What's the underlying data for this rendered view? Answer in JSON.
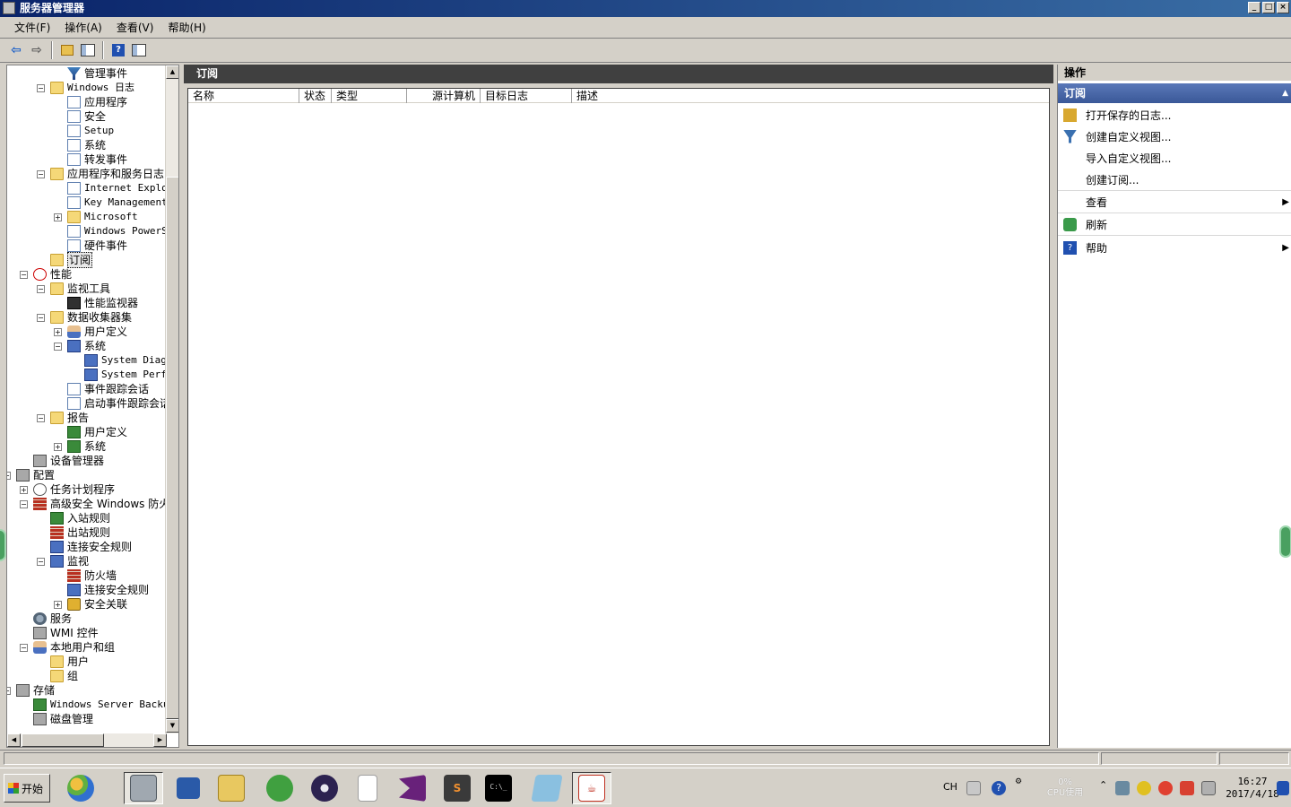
{
  "window": {
    "title": "服务器管理器"
  },
  "menu": [
    "文件(F)",
    "操作(A)",
    "查看(V)",
    "帮助(H)"
  ],
  "tree": [
    {
      "label": "管理事件",
      "depth": 3,
      "icon": "filter",
      "expander": ""
    },
    {
      "label": "Windows 日志",
      "depth": 2,
      "icon": "folder",
      "expander": "−",
      "mono": true
    },
    {
      "label": "应用程序",
      "depth": 3,
      "icon": "log",
      "expander": ""
    },
    {
      "label": "安全",
      "depth": 3,
      "icon": "log",
      "expander": ""
    },
    {
      "label": "Setup",
      "depth": 3,
      "icon": "log",
      "expander": "",
      "mono": true
    },
    {
      "label": "系统",
      "depth": 3,
      "icon": "log",
      "expander": ""
    },
    {
      "label": "转发事件",
      "depth": 3,
      "icon": "log",
      "expander": ""
    },
    {
      "label": "应用程序和服务日志",
      "depth": 2,
      "icon": "folder",
      "expander": "−"
    },
    {
      "label": "Internet Explor",
      "depth": 3,
      "icon": "log",
      "expander": "",
      "mono": true
    },
    {
      "label": "Key Management",
      "depth": 3,
      "icon": "log",
      "expander": "",
      "mono": true
    },
    {
      "label": "Microsoft",
      "depth": 3,
      "icon": "folder",
      "expander": "+",
      "mono": true
    },
    {
      "label": "Windows PowerSl",
      "depth": 3,
      "icon": "log",
      "expander": "",
      "mono": true
    },
    {
      "label": "硬件事件",
      "depth": 3,
      "icon": "log",
      "expander": ""
    },
    {
      "label": "订阅",
      "depth": 2,
      "icon": "folder",
      "expander": "",
      "selected": true
    },
    {
      "label": "性能",
      "depth": 1,
      "icon": "perf",
      "expander": "−"
    },
    {
      "label": "监视工具",
      "depth": 2,
      "icon": "folder",
      "expander": "−"
    },
    {
      "label": "性能监视器",
      "depth": 3,
      "icon": "monitor",
      "expander": ""
    },
    {
      "label": "数据收集器集",
      "depth": 2,
      "icon": "folder",
      "expander": "−"
    },
    {
      "label": "用户定义",
      "depth": 3,
      "icon": "user",
      "expander": "+"
    },
    {
      "label": "系统",
      "depth": 3,
      "icon": "blue",
      "expander": "−"
    },
    {
      "label": "System Diag",
      "depth": 4,
      "icon": "blue",
      "expander": "",
      "mono": true
    },
    {
      "label": "System Perf",
      "depth": 4,
      "icon": "blue",
      "expander": "",
      "mono": true
    },
    {
      "label": "事件跟踪会话",
      "depth": 3,
      "icon": "log",
      "expander": ""
    },
    {
      "label": "启动事件跟踪会话",
      "depth": 3,
      "icon": "log",
      "expander": ""
    },
    {
      "label": "报告",
      "depth": 2,
      "icon": "folder",
      "expander": "−"
    },
    {
      "label": "用户定义",
      "depth": 3,
      "icon": "green",
      "expander": ""
    },
    {
      "label": "系统",
      "depth": 3,
      "icon": "green",
      "expander": "+"
    },
    {
      "label": "设备管理器",
      "depth": 1,
      "icon": "pc",
      "expander": ""
    },
    {
      "label": "配置",
      "depth": 0,
      "icon": "pc",
      "expander": "−"
    },
    {
      "label": "任务计划程序",
      "depth": 1,
      "icon": "clock",
      "expander": "+"
    },
    {
      "label": "高级安全 Windows 防火",
      "depth": 1,
      "icon": "wall",
      "expander": "−"
    },
    {
      "label": "入站规则",
      "depth": 2,
      "icon": "green",
      "expander": ""
    },
    {
      "label": "出站规则",
      "depth": 2,
      "icon": "wall",
      "expander": ""
    },
    {
      "label": "连接安全规则",
      "depth": 2,
      "icon": "blue",
      "expander": ""
    },
    {
      "label": "监视",
      "depth": 2,
      "icon": "blue",
      "expander": "−"
    },
    {
      "label": "防火墙",
      "depth": 3,
      "icon": "wall",
      "expander": ""
    },
    {
      "label": "连接安全规则",
      "depth": 3,
      "icon": "blue",
      "expander": ""
    },
    {
      "label": "安全关联",
      "depth": 3,
      "icon": "lock",
      "expander": "+"
    },
    {
      "label": "服务",
      "depth": 1,
      "icon": "gear",
      "expander": ""
    },
    {
      "label": "WMI 控件",
      "depth": 1,
      "icon": "pc",
      "expander": ""
    },
    {
      "label": "本地用户和组",
      "depth": 1,
      "icon": "user",
      "expander": "−"
    },
    {
      "label": "用户",
      "depth": 2,
      "icon": "folder",
      "expander": ""
    },
    {
      "label": "组",
      "depth": 2,
      "icon": "folder",
      "expander": ""
    },
    {
      "label": "存储",
      "depth": 0,
      "icon": "pc",
      "expander": "−"
    },
    {
      "label": "Windows Server Backup",
      "depth": 1,
      "icon": "green",
      "expander": "",
      "mono": true
    },
    {
      "label": "磁盘管理",
      "depth": 1,
      "icon": "pc",
      "expander": ""
    }
  ],
  "center": {
    "title": "订阅",
    "columns": [
      "名称",
      "状态",
      "类型",
      "源计算机",
      "目标日志",
      "描述"
    ]
  },
  "actions": {
    "title": "操作",
    "section": "订阅",
    "items": [
      {
        "label": "打开保存的日志...",
        "icon": "folder-open-icon",
        "color": "#d8a830",
        "submenu": false,
        "sep": false
      },
      {
        "label": "创建自定义视图...",
        "icon": "filter-icon",
        "color": "#3a70b0",
        "submenu": false,
        "sep": false
      },
      {
        "label": "导入自定义视图...",
        "icon": "",
        "color": "",
        "submenu": false,
        "sep": false
      },
      {
        "label": "创建订阅...",
        "icon": "",
        "color": "",
        "submenu": false,
        "sep": true
      },
      {
        "label": "查看",
        "icon": "",
        "color": "",
        "submenu": true,
        "sep": true
      },
      {
        "label": "刷新",
        "icon": "refresh-icon",
        "color": "#3a9a4a",
        "submenu": false,
        "sep": true
      },
      {
        "label": "帮助",
        "icon": "help-icon",
        "color": "#2050b0",
        "submenu": true,
        "sep": false
      }
    ]
  },
  "taskbar": {
    "start": "开始",
    "lang": "CH",
    "cpu_percent": "0%",
    "cpu_label": "CPU使用",
    "time": "16:27",
    "date": "2017/4/18"
  }
}
